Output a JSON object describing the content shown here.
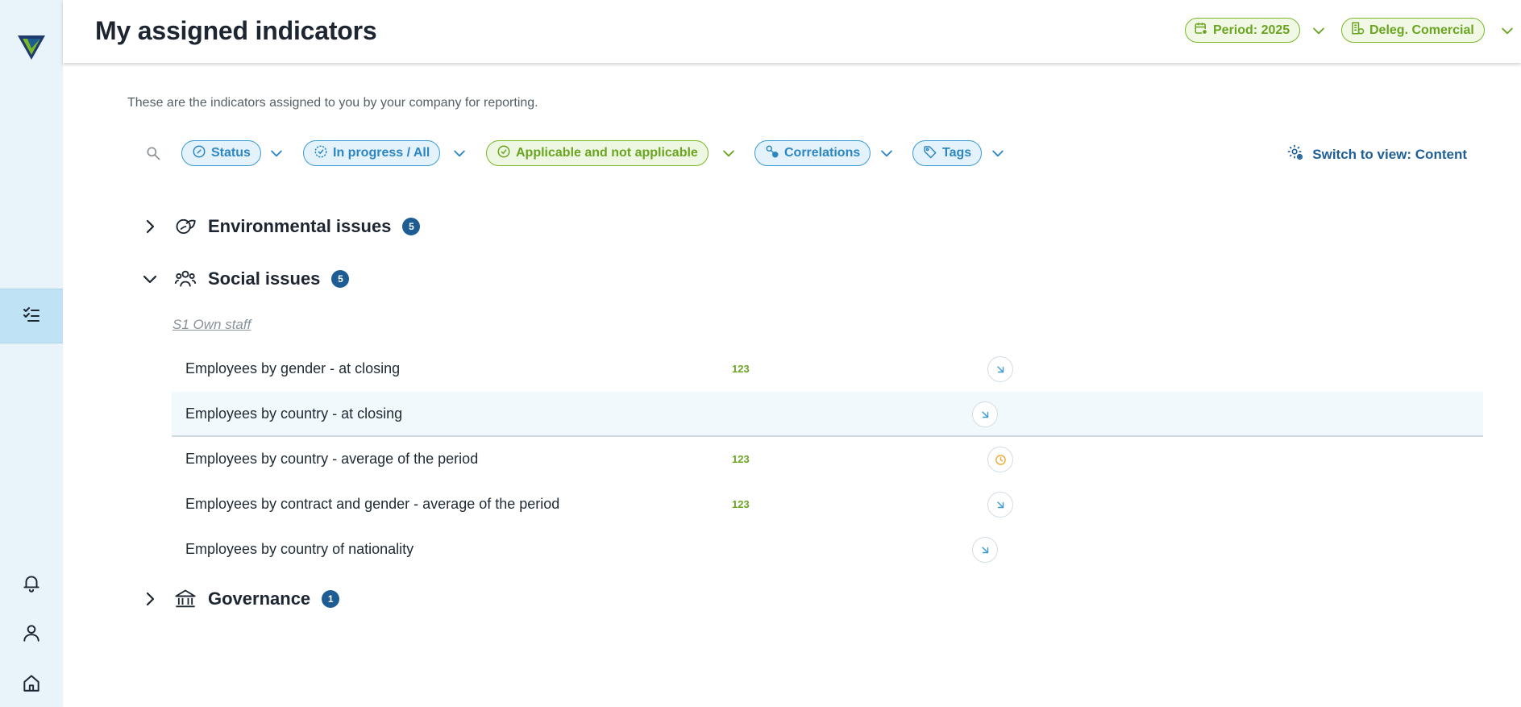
{
  "header": {
    "title": "My assigned indicators",
    "period_label": "Period: 2025",
    "delegation_label": "Deleg. Comercial"
  },
  "subtitle": "These are the indicators assigned to you by your company for reporting.",
  "filters": {
    "status": "Status",
    "progress": "In progress / All",
    "applicability": "Applicable and not applicable",
    "correlations": "Correlations",
    "tags": "Tags",
    "switch_view": "Switch to view: Content"
  },
  "sections": [
    {
      "title": "Environmental issues",
      "count": "5",
      "expanded": false
    },
    {
      "title": "Social issues",
      "count": "5",
      "expanded": true
    },
    {
      "title": "Governance",
      "count": "1",
      "expanded": false
    }
  ],
  "social": {
    "group_label": "S1 Own staff",
    "rows": [
      {
        "name": "Employees by gender - at closing",
        "num": "123",
        "status": "assigned-icon"
      },
      {
        "name": "Employees by country - at closing",
        "num": "",
        "status": "assigned-icon"
      },
      {
        "name": "Employees by country - average of the period",
        "num": "123",
        "status": "pending-clock-icon"
      },
      {
        "name": "Employees by contract and gender - average of the period",
        "num": "123",
        "status": "assigned-icon"
      },
      {
        "name": "Employees by country of nationality",
        "num": "",
        "status": "assigned-icon"
      }
    ]
  },
  "colors": {
    "brand_blue": "#1e5c94",
    "accent_green": "#7ab829",
    "filter_blue": "#3a9ad4",
    "status_orange": "#f0a830",
    "sidebar_bg": "#e8f4fa"
  }
}
